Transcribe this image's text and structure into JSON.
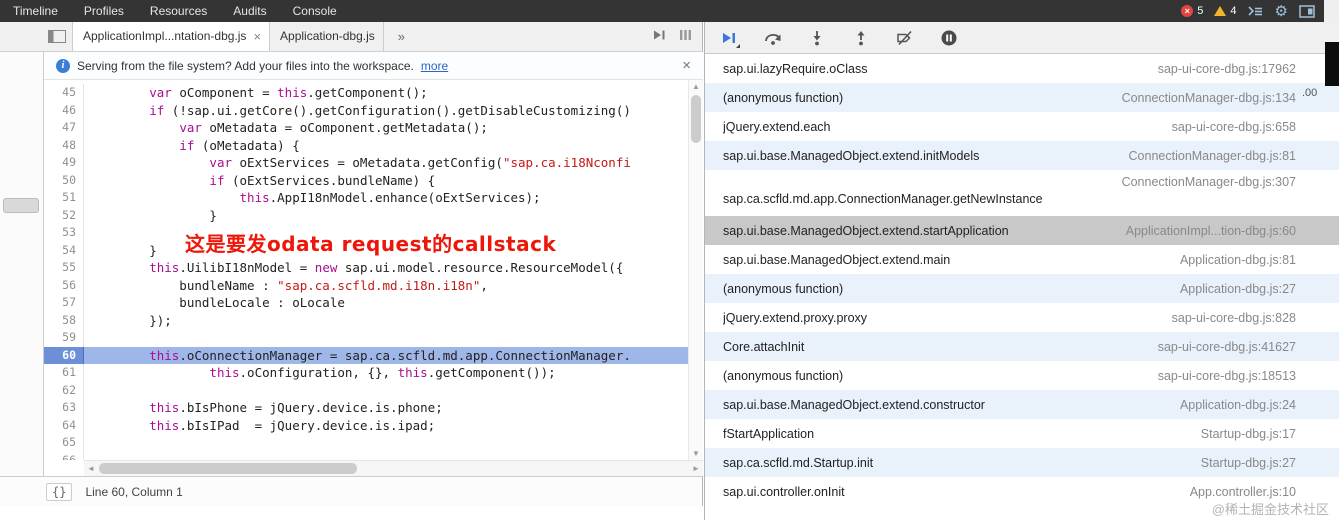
{
  "topbar": {
    "tabs": [
      "Timeline",
      "Profiles",
      "Resources",
      "Audits",
      "Console"
    ],
    "error_count": "5",
    "warning_count": "4"
  },
  "icons": {
    "close": "×",
    "overflow_chevron": "»",
    "info": "i",
    "braces": "{}",
    "scroll_up": "▲",
    "scroll_down": "▼",
    "scroll_left": "◄",
    "scroll_right": "►"
  },
  "editor": {
    "file_tabs": [
      {
        "label": "ApplicationImpl...ntation-dbg.js",
        "selected": true,
        "closable": true
      },
      {
        "label": "Application-dbg.js",
        "selected": false,
        "closable": false
      }
    ],
    "infobar": {
      "text": "Serving from the file system? Add your files into the workspace.",
      "link": "more"
    },
    "annotation": "这是要发odata request的callstack",
    "status_text": "Line 60, Column 1",
    "code": {
      "current_line": 60,
      "lines": [
        {
          "n": 45,
          "s": [
            [
              "p",
              "        "
            ],
            [
              "k",
              "var"
            ],
            [
              "p",
              " oComponent = "
            ],
            [
              "k",
              "this"
            ],
            [
              "p",
              ".getComponent();"
            ]
          ]
        },
        {
          "n": 46,
          "s": [
            [
              "p",
              "        "
            ],
            [
              "k",
              "if"
            ],
            [
              "p",
              " (!sap.ui.getCore().getConfiguration().getDisableCustomizing()"
            ]
          ]
        },
        {
          "n": 47,
          "s": [
            [
              "p",
              "            "
            ],
            [
              "k",
              "var"
            ],
            [
              "p",
              " oMetadata = oComponent.getMetadata();"
            ]
          ]
        },
        {
          "n": 48,
          "s": [
            [
              "p",
              "            "
            ],
            [
              "k",
              "if"
            ],
            [
              "p",
              " (oMetadata) {"
            ]
          ]
        },
        {
          "n": 49,
          "s": [
            [
              "p",
              "                "
            ],
            [
              "k",
              "var"
            ],
            [
              "p",
              " oExtServices = oMetadata.getConfig("
            ],
            [
              "s",
              "\"sap.ca.i18Nconfi"
            ]
          ]
        },
        {
          "n": 50,
          "s": [
            [
              "p",
              "                "
            ],
            [
              "k",
              "if"
            ],
            [
              "p",
              " (oExtServices.bundleName) {"
            ]
          ]
        },
        {
          "n": 51,
          "s": [
            [
              "p",
              "                    "
            ],
            [
              "k",
              "this"
            ],
            [
              "p",
              ".AppI18nModel.enhance(oExtServices);"
            ]
          ]
        },
        {
          "n": 52,
          "s": [
            [
              "p",
              "                }"
            ]
          ]
        },
        {
          "n": 53,
          "s": []
        },
        {
          "n": 54,
          "s": [
            [
              "p",
              "        }"
            ]
          ]
        },
        {
          "n": 55,
          "s": [
            [
              "p",
              "        "
            ],
            [
              "k",
              "this"
            ],
            [
              "p",
              ".UilibI18nModel = "
            ],
            [
              "k",
              "new"
            ],
            [
              "p",
              " sap.ui.model.resource.ResourceModel({"
            ]
          ]
        },
        {
          "n": 56,
          "s": [
            [
              "p",
              "            bundleName : "
            ],
            [
              "s",
              "\"sap.ca.scfld.md.i18n.i18n\""
            ],
            [
              "p",
              ","
            ]
          ]
        },
        {
          "n": 57,
          "s": [
            [
              "p",
              "            bundleLocale : oLocale"
            ]
          ]
        },
        {
          "n": 58,
          "s": [
            [
              "p",
              "        });"
            ]
          ]
        },
        {
          "n": 59,
          "s": []
        },
        {
          "n": 60,
          "s": [
            [
              "p",
              "        "
            ],
            [
              "k",
              "this"
            ],
            [
              "p",
              ".oConnectionManager = sap.ca.scfld.md.app.ConnectionManager."
            ]
          ]
        },
        {
          "n": 61,
          "s": [
            [
              "p",
              "                "
            ],
            [
              "k",
              "this"
            ],
            [
              "p",
              ".oConfiguration, {}, "
            ],
            [
              "k",
              "this"
            ],
            [
              "p",
              ".getComponent());"
            ]
          ]
        },
        {
          "n": 62,
          "s": []
        },
        {
          "n": 63,
          "s": [
            [
              "p",
              "        "
            ],
            [
              "k",
              "this"
            ],
            [
              "p",
              ".bIsPhone = jQuery.device.is.phone;"
            ]
          ]
        },
        {
          "n": 64,
          "s": [
            [
              "p",
              "        "
            ],
            [
              "k",
              "this"
            ],
            [
              "p",
              ".bIsIPad  = jQuery.device.is.ipad;"
            ]
          ]
        },
        {
          "n": 65,
          "s": []
        },
        {
          "n": 66,
          "s": []
        }
      ]
    }
  },
  "callstack": {
    "frames": [
      {
        "fn": "sap.ui.lazyRequire.oClass",
        "loc": "sap-ui-core-dbg.js:17962"
      },
      {
        "fn": "(anonymous function)",
        "loc": "ConnectionManager-dbg.js:134"
      },
      {
        "fn": "jQuery.extend.each",
        "loc": "sap-ui-core-dbg.js:658"
      },
      {
        "fn": "sap.ui.base.ManagedObject.extend.initModels",
        "loc": "ConnectionManager-dbg.js:81"
      },
      {
        "fn": "sap.ca.scfld.md.app.ConnectionManager.getNewInstance",
        "loc": "ConnectionManager-dbg.js:307",
        "wrapped": true
      },
      {
        "fn": "sap.ui.base.ManagedObject.extend.startApplication",
        "loc": "ApplicationImpl...tion-dbg.js:60",
        "selected": true
      },
      {
        "fn": "sap.ui.base.ManagedObject.extend.main",
        "loc": "Application-dbg.js:81"
      },
      {
        "fn": "(anonymous function)",
        "loc": "Application-dbg.js:27"
      },
      {
        "fn": "jQuery.extend.proxy.proxy",
        "loc": "sap-ui-core-dbg.js:828"
      },
      {
        "fn": "Core.attachInit",
        "loc": "sap-ui-core-dbg.js:41627"
      },
      {
        "fn": "(anonymous function)",
        "loc": "sap-ui-core-dbg.js:18513"
      },
      {
        "fn": "sap.ui.base.ManagedObject.extend.constructor",
        "loc": "Application-dbg.js:24"
      },
      {
        "fn": "fStartApplication",
        "loc": "Startup-dbg.js:17"
      },
      {
        "fn": "sap.ca.scfld.md.Startup.init",
        "loc": "Startup-dbg.js:27"
      },
      {
        "fn": "sap.ui.controller.onInit",
        "loc": "App.controller.js:10"
      }
    ]
  },
  "watermark": "@稀土掘金技术社区",
  "fragment_text": ".00",
  "colors": {
    "accent_blue": "#3879d9",
    "error_red": "#e5443f",
    "warning_yellow": "#f2b42c",
    "execution_line": "#9fb6e8",
    "execution_gutter": "#6d8fd8",
    "selected_frame": "#c8c8c8",
    "zebra_row": "#e9f1fb",
    "keyword_color": "#aa0d91",
    "string_color": "#c41a16"
  }
}
